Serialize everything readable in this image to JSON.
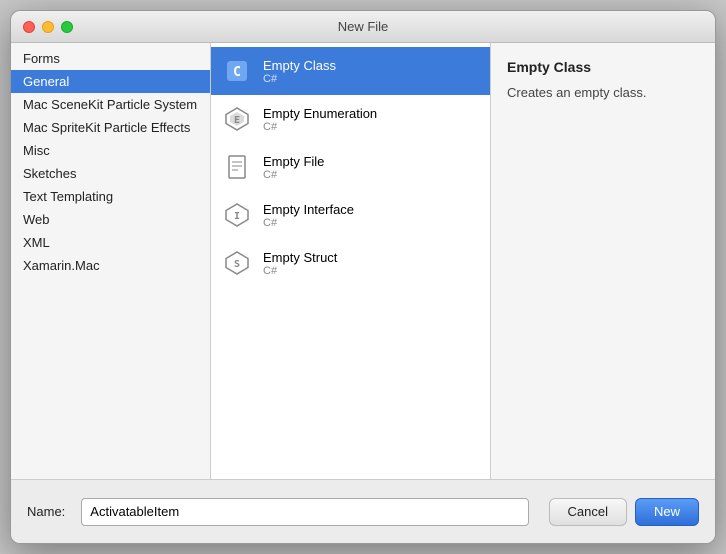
{
  "window": {
    "title": "New File"
  },
  "sidebar": {
    "items": [
      {
        "id": "forms",
        "label": "Forms"
      },
      {
        "id": "general",
        "label": "General",
        "selected": true
      },
      {
        "id": "mac-scenekit",
        "label": "Mac SceneKit Particle System"
      },
      {
        "id": "mac-spritekit",
        "label": "Mac SpriteKit Particle Effects"
      },
      {
        "id": "misc",
        "label": "Misc"
      },
      {
        "id": "sketches",
        "label": "Sketches"
      },
      {
        "id": "text-templating",
        "label": "Text Templating"
      },
      {
        "id": "web",
        "label": "Web"
      },
      {
        "id": "xml",
        "label": "XML"
      },
      {
        "id": "xamarin-mac",
        "label": "Xamarin.Mac"
      }
    ]
  },
  "fileList": {
    "items": [
      {
        "id": "empty-class",
        "title": "Empty Class",
        "subtitle": "C#",
        "selected": true,
        "iconType": "class"
      },
      {
        "id": "empty-enumeration",
        "title": "Empty Enumeration",
        "subtitle": "C#",
        "selected": false,
        "iconType": "enum"
      },
      {
        "id": "empty-file",
        "title": "Empty File",
        "subtitle": "C#",
        "selected": false,
        "iconType": "file"
      },
      {
        "id": "empty-interface",
        "title": "Empty Interface",
        "subtitle": "C#",
        "selected": false,
        "iconType": "interface"
      },
      {
        "id": "empty-struct",
        "title": "Empty Struct",
        "subtitle": "C#",
        "selected": false,
        "iconType": "struct"
      }
    ]
  },
  "description": {
    "title": "Empty Class",
    "body": "Creates an empty class."
  },
  "bottomBar": {
    "nameLabel": "Name:",
    "nameValue": "ActivatableItem",
    "cancelLabel": "Cancel",
    "newLabel": "New"
  }
}
